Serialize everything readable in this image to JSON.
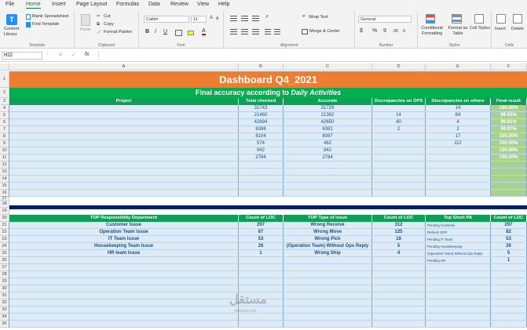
{
  "menu_tabs": [
    "File",
    "Home",
    "Insert",
    "Page Layout",
    "Formulas",
    "Data",
    "Review",
    "View",
    "Help"
  ],
  "ribbon": {
    "templates": {
      "content_library": "Content Library",
      "blank_spreadsheet": "Blank Spreadsheet",
      "find_template": "Find Template",
      "group": "Template"
    },
    "clipboard": {
      "paste": "Paste",
      "cut": "Cut",
      "copy": "Copy",
      "format_painter": "Format Painter",
      "group": "Clipboard"
    },
    "font": {
      "name": "Calibri",
      "size": "11",
      "group": "Font",
      "bold": "B",
      "italic": "I",
      "underline": "U"
    },
    "alignment": {
      "wrap_text": "Wrap Text",
      "merge_center": "Merge & Center",
      "group": "Alignment"
    },
    "number": {
      "format": "General",
      "currency": "$",
      "percent": "%",
      "comma": "9",
      "group": "Number",
      "dec_inc": ".00",
      "dec_dec": ".0"
    },
    "styles": {
      "conditional": "Conditional Formatting",
      "format_table": "Format as Table",
      "cell_styles": "Cell Styles",
      "group": "Styles"
    },
    "cells": {
      "insert": "Insert",
      "delete": "Delete",
      "group": "Cells"
    }
  },
  "formula_bar": {
    "name_box": "H22",
    "fx": "fx"
  },
  "columns": [
    "A",
    "B",
    "C",
    "D",
    "E",
    "F"
  ],
  "rows": [
    "1",
    "2",
    "3",
    "4",
    "5",
    "6",
    "7",
    "8",
    "9",
    "10",
    "11",
    "12",
    "13",
    "14",
    "15",
    "16",
    "17",
    "18",
    "19",
    "20",
    "21",
    "22",
    "23",
    "24",
    "25",
    "26",
    "27",
    "28",
    "29",
    "30",
    "31",
    "32",
    "33",
    "34",
    "35"
  ],
  "sheet": {
    "title_prefix": "Dashboard Q4_2021",
    "subtitle_prefix": "Final accuracy according to",
    "subtitle_italic": "Daily Activities",
    "headers1": [
      "Project",
      "Total checked",
      "Accurate",
      "Discrepancies on OPS",
      "Discrepancies on others",
      "Final result"
    ],
    "table1": [
      [
        "",
        "31743",
        "31729",
        "",
        "14",
        "100.00%"
      ],
      [
        "",
        "21460",
        "21362",
        "14",
        "84",
        "99.93%"
      ],
      [
        "",
        "42694",
        "42650",
        "40",
        "4",
        "99.91%"
      ],
      [
        "",
        "6386",
        "6382",
        "2",
        "2",
        "99.97%"
      ],
      [
        "",
        "8104",
        "8087",
        "",
        "17",
        "100.00%"
      ],
      [
        "",
        "574",
        "462",
        "",
        "112",
        "100.00%"
      ],
      [
        "",
        "942",
        "942",
        "",
        "",
        "100.00%"
      ],
      [
        "",
        "2784",
        "2784",
        "",
        "",
        "100.00%"
      ]
    ],
    "headers2": [
      "TOP Responsiblity Department",
      "Count of LOC",
      "TOP Type of issue",
      "Count of LOC",
      "Top Short PA",
      "Count of LOC"
    ],
    "table2": [
      [
        "Customer Issue",
        "297",
        "Wrong Receive",
        "312",
        "Pending Customer",
        "297"
      ],
      [
        "Operation Team Issue",
        "87",
        "Wrong Move",
        "125",
        "Refresh SOP",
        "82"
      ],
      [
        "IT Team Issue",
        "53",
        "Wrong Pick",
        "18",
        "Pending IT Team",
        "53"
      ],
      [
        "Housekeeping Team Issue",
        "26",
        "(Operation Team) Without Ops Reply",
        "5",
        "Pending Housekeeping",
        "26"
      ],
      [
        "HR team Issue",
        "1",
        "Wrong Ship",
        "4",
        "(Operation Team) Without Ops Reply",
        "5"
      ],
      [
        "",
        "",
        "",
        "",
        "Pending HR",
        "1"
      ]
    ],
    "watermark": "مستقل",
    "watermark_sub": "mostaql.com"
  },
  "colors": {
    "orange": "#ed7d31",
    "green": "#00b050",
    "header_green": "#0f9d58",
    "light_blue": "#ddebf7",
    "result_green": "#92d050",
    "navy": "#002060",
    "text_blue": "#1f4e79"
  }
}
